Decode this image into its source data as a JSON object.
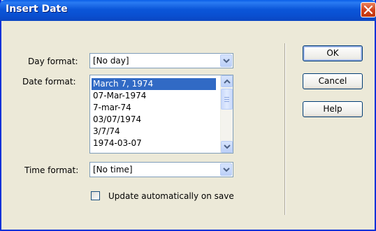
{
  "window": {
    "title": "Insert Date"
  },
  "day_format": {
    "label": "Day format:",
    "value": "[No day]"
  },
  "date_format": {
    "label": "Date format:",
    "items": [
      "March 7, 1974",
      "07-Mar-1974",
      "7-mar-74",
      "03/07/1974",
      "3/7/74",
      "1974-03-07"
    ],
    "selected": "March 7, 1974"
  },
  "time_format": {
    "label": "Time format:",
    "value": "[No time]"
  },
  "update_checkbox": {
    "label": "Update automatically on save",
    "checked": false
  },
  "buttons": {
    "ok": "OK",
    "cancel": "Cancel",
    "help": "Help"
  },
  "colors": {
    "title_bar": "#0b56d9",
    "selection": "#316ac5",
    "dialog_bg": "#ece9d8"
  }
}
